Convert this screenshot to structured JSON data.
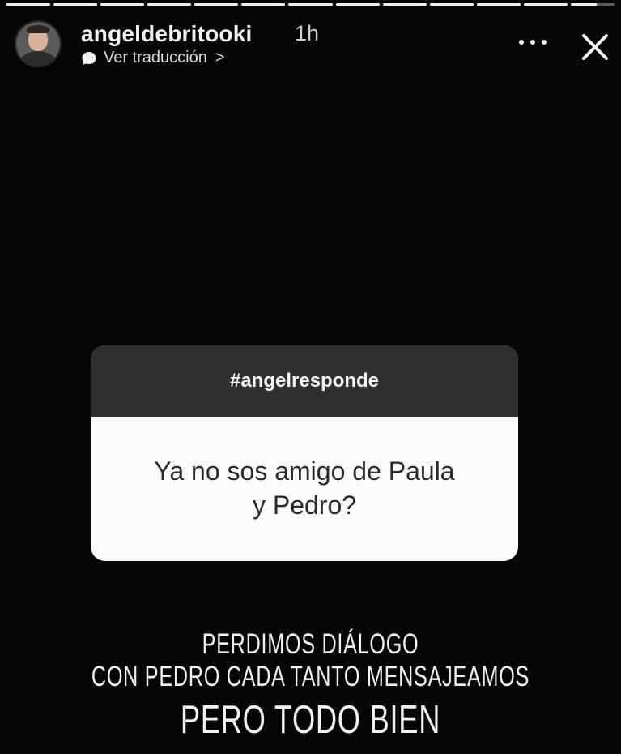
{
  "story": {
    "progress": [
      1,
      1,
      1,
      1,
      1,
      1,
      1,
      1,
      1,
      1,
      1,
      1,
      0.6
    ],
    "header": {
      "username": "angeldebritooki",
      "time": "1h",
      "translate_label": "Ver traducción",
      "translate_chevron": ">"
    },
    "question": {
      "hashtag": "#angelresponde",
      "text_line_1": "Ya no sos amigo de Paula",
      "text_line_2": "y Pedro?"
    },
    "answer": {
      "line_1": "PERDIMOS  DIÁLOGO",
      "line_2": "CON PEDRO CADA TANTO MENSAJEAMOS",
      "line_3": "PERO TODO BIEN"
    }
  },
  "icons": {
    "more": "more-icon",
    "close": "close-icon",
    "translate": "translate-icon"
  },
  "colors": {
    "background": "#060606",
    "card_header": "#2f2f2f",
    "card_body": "#fbfbfb",
    "text_light": "#f2f2f2",
    "text_dark": "#2a2a2a"
  }
}
